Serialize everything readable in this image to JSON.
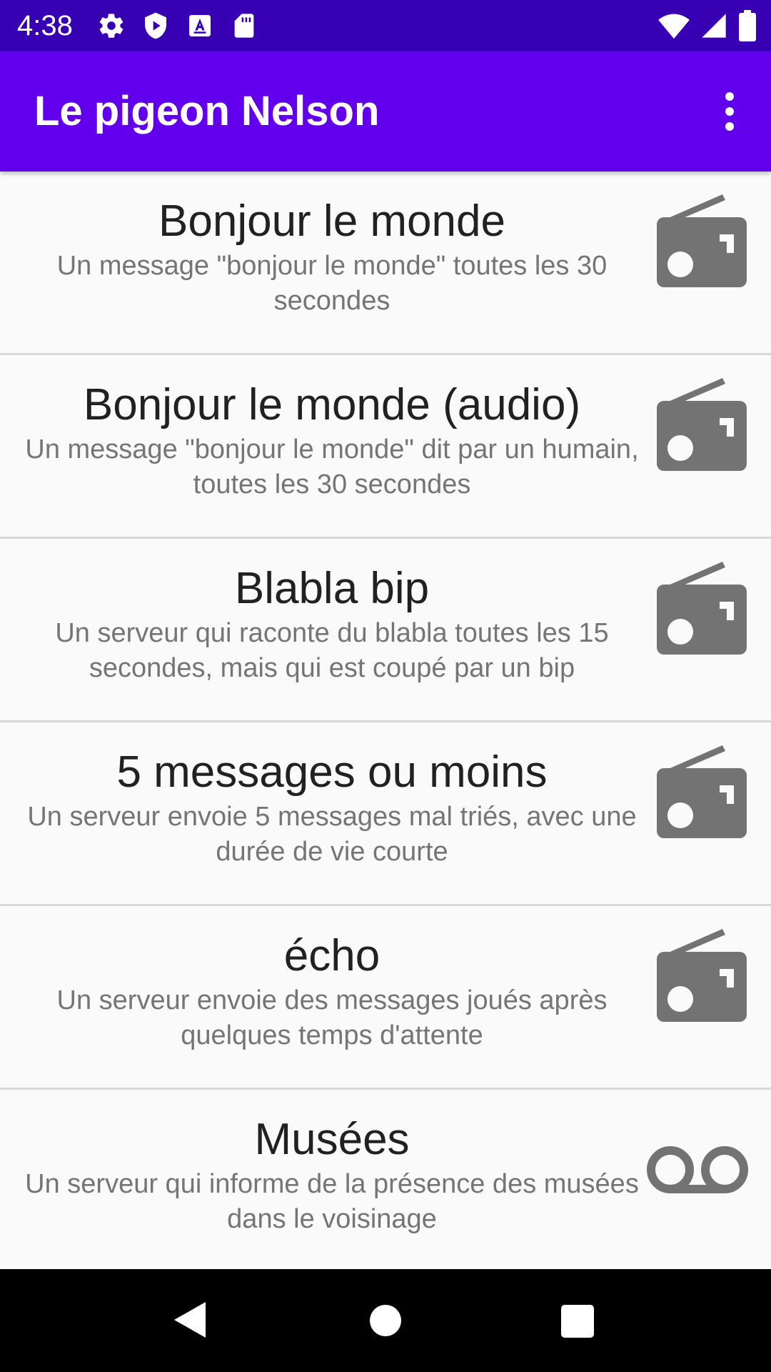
{
  "status_bar": {
    "time": "4:38",
    "left_icons": [
      "gear-icon",
      "play-protect-icon",
      "accessibility-icon",
      "sd-card-icon"
    ],
    "right_icons": [
      "wifi-icon",
      "cellular-signal-icon",
      "battery-icon"
    ]
  },
  "app_bar": {
    "title": "Le pigeon Nelson",
    "overflow_icon": "more-vert-icon"
  },
  "servers": [
    {
      "title": "Bonjour le monde",
      "description": "Un message \"bonjour le monde\" toutes les 30 secondes",
      "icon": "radio-icon"
    },
    {
      "title": "Bonjour le monde (audio)",
      "description": "Un message \"bonjour le monde\" dit par un humain, toutes les 30 secondes",
      "icon": "radio-icon"
    },
    {
      "title": "Blabla bip",
      "description": "Un serveur qui raconte du blabla toutes les 15 secondes, mais qui est coupé par un bip",
      "icon": "radio-icon"
    },
    {
      "title": "5 messages ou moins",
      "description": "Un serveur envoie 5 messages mal triés, avec une durée de vie courte",
      "icon": "radio-icon"
    },
    {
      "title": "écho",
      "description": "Un serveur envoie des messages joués après quelques temps d'attente",
      "icon": "radio-icon"
    },
    {
      "title": "Musées",
      "description": "Un serveur qui informe de la présence des musées dans le voisinage",
      "icon": "voicemail-icon"
    }
  ],
  "nav_bar": {
    "back_icon": "back-triangle-icon",
    "home_icon": "home-circle-icon",
    "recents_icon": "recents-square-icon"
  },
  "colors": {
    "status_bar": "#3700b3",
    "app_bar": "#6200ee",
    "icon_grey": "#737373",
    "title_text": "#212121",
    "description_text": "#757575"
  }
}
